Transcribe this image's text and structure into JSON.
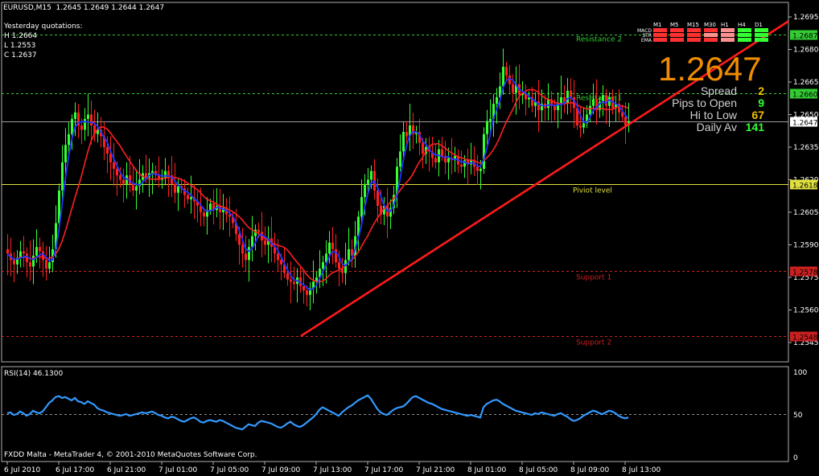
{
  "chart_title": "EURUSD,M15  1.2645 1.2649 1.2644 1.2647",
  "yesterday": {
    "label": "Yesterday quotations:",
    "high": "H 1.2664",
    "low": "L 1.2553",
    "close": "C 1.2637"
  },
  "info_panel": {
    "price": "1.2647",
    "rows": [
      {
        "label": "Spread",
        "value": "2",
        "color": "#f0c000"
      },
      {
        "label": "Pips to Open",
        "value": "9",
        "color": "#33ff33"
      },
      {
        "label": "Hi to Low",
        "value": "67",
        "color": "#f0c000"
      },
      {
        "label": "Daily Av",
        "value": "141",
        "color": "#33ff33"
      }
    ]
  },
  "signal_matrix": {
    "timeframes": [
      "M1",
      "M5",
      "M15",
      "M30",
      "H1",
      "H4",
      "D1"
    ],
    "indicators": [
      "MACD",
      "STR",
      "EMA"
    ],
    "cells": [
      [
        "#ff3030",
        "#ff3030",
        "#ff3030",
        "#ff3030",
        "#ff9090",
        "#33ff33",
        "#33ff33"
      ],
      [
        "#ff3030",
        "#ff3030",
        "#ff3030",
        "#ff9090",
        "#ff9090",
        "#33ff33",
        "#33ff33"
      ],
      [
        "#ff3030",
        "#ff3030",
        "#ff3030",
        "#ff3030",
        "#ff9090",
        "#33ff33",
        "#33ff33"
      ]
    ]
  },
  "levels": [
    {
      "name": "Resistance 2",
      "label": "Resistance 2",
      "price": 1.2687,
      "tag": "1.2687",
      "color": "#33cc33",
      "tag_bg": "#33cc33",
      "tag_fg": "#000000",
      "dashed": true
    },
    {
      "name": "Resistance 1",
      "label": "Resistance 1",
      "price": 1.266,
      "tag": "1.2660",
      "color": "#33cc33",
      "tag_bg": "#33cc33",
      "tag_fg": "#000000",
      "dashed": true
    },
    {
      "name": "current-price",
      "label": "",
      "price": 1.2647,
      "tag": "1.2647",
      "color": "#a0a0a0",
      "tag_bg": "#ffffff",
      "tag_fg": "#000000",
      "dashed": false
    },
    {
      "name": "Piviot level",
      "label": "Piviot level",
      "price": 1.2618,
      "tag": "1.2618",
      "color": "#e0e040",
      "tag_bg": "#e0e040",
      "tag_fg": "#000000",
      "dashed": false
    },
    {
      "name": "Support 1",
      "label": "Support 1",
      "price": 1.2578,
      "tag": "1.2578",
      "color": "#cc2020",
      "tag_bg": "#cc2020",
      "tag_fg": "#000000",
      "dashed": true
    },
    {
      "name": "Support 2",
      "label": "Support 2",
      "price": 1.2548,
      "tag": "1.2548",
      "color": "#cc2020",
      "tag_bg": "#cc2020",
      "tag_fg": "#000000",
      "dashed": true
    }
  ],
  "rsi": {
    "label": "RSI(14) 46.1300",
    "ticks": [
      "100",
      "50",
      "0"
    ],
    "level": 50
  },
  "footer": "FXDD Malta - MetaTrader 4, © 2001-2010 MetaQuotes Software Corp.",
  "colors": {
    "bull": "#33ff33",
    "bear": "#ff2020",
    "fast_ma": "#2233ff",
    "slow_ma": "#ff2020",
    "trendline": "#ff1a1a",
    "rsi": "#3399ff"
  },
  "chart_data": [
    {
      "type": "candlestick",
      "title": "EURUSD,M15",
      "ylim": [
        1.254,
        1.27
      ],
      "y_ticks": [
        "1.2695",
        "1.2680",
        "1.2665",
        "1.2650",
        "1.2635",
        "1.2620",
        "1.2605",
        "1.2590",
        "1.2575",
        "1.2560",
        "1.2545"
      ],
      "x_ticks": [
        "6 Jul 2010",
        "6 Jul 17:00",
        "6 Jul 21:00",
        "7 Jul 01:00",
        "7 Jul 05:00",
        "7 Jul 09:00",
        "7 Jul 13:00",
        "7 Jul 17:00",
        "7 Jul 21:00",
        "8 Jul 01:00",
        "8 Jul 05:00",
        "8 Jul 09:00",
        "8 Jul 13:00"
      ],
      "bars_per_tick": 16,
      "trendline": {
        "from": {
          "x": "7 Jul 12:00",
          "y": 1.2548
        },
        "to": {
          "x": "8 Jul 15:45",
          "y": 1.2693
        }
      },
      "fast_ma_offset": 0.0003,
      "slow_ma_offset": 0.001,
      "close": [
        1.2586,
        1.2583,
        1.2581,
        1.2584,
        1.2587,
        1.2586,
        1.2582,
        1.258,
        1.2585,
        1.2589,
        1.2587,
        1.2583,
        1.2579,
        1.2582,
        1.2588,
        1.26,
        1.2615,
        1.2628,
        1.2636,
        1.2641,
        1.2648,
        1.2651,
        1.2645,
        1.2643,
        1.2648,
        1.265,
        1.2645,
        1.2641,
        1.2643,
        1.264,
        1.2635,
        1.2632,
        1.2628,
        1.2625,
        1.2622,
        1.262,
        1.2618,
        1.2622,
        1.2618,
        1.2615,
        1.2617,
        1.262,
        1.2623,
        1.2621,
        1.2623,
        1.2624,
        1.2622,
        1.262,
        1.2621,
        1.2624,
        1.2622,
        1.2618,
        1.2614,
        1.2617,
        1.2616,
        1.2613,
        1.2611,
        1.2612,
        1.261,
        1.2608,
        1.2605,
        1.2603,
        1.2606,
        1.2609,
        1.2606,
        1.2608,
        1.2605,
        1.2607,
        1.2604,
        1.2603,
        1.26,
        1.2595,
        1.259,
        1.2586,
        1.2583,
        1.2589,
        1.2594,
        1.2597,
        1.2596,
        1.2592,
        1.259,
        1.2593,
        1.2589,
        1.2586,
        1.2583,
        1.2581,
        1.2577,
        1.2574,
        1.2573,
        1.2572,
        1.2575,
        1.2571,
        1.2569,
        1.2567,
        1.257,
        1.2573,
        1.2575,
        1.2579,
        1.2582,
        1.2586,
        1.2591,
        1.2588,
        1.2582,
        1.2579,
        1.2577,
        1.2583,
        1.2588,
        1.2585,
        1.2594,
        1.2603,
        1.2612,
        1.2618,
        1.262,
        1.2624,
        1.2615,
        1.2608,
        1.2604,
        1.2608,
        1.2603,
        1.2607,
        1.2613,
        1.2626,
        1.2633,
        1.2642,
        1.264,
        1.2645,
        1.2641,
        1.2642,
        1.2637,
        1.2632,
        1.2635,
        1.2633,
        1.263,
        1.2628,
        1.2634,
        1.2631,
        1.2628,
        1.263,
        1.2629,
        1.2631,
        1.2627,
        1.2626,
        1.2629,
        1.2627,
        1.2629,
        1.2626,
        1.2624,
        1.2625,
        1.2641,
        1.2647,
        1.2648,
        1.2655,
        1.2658,
        1.2663,
        1.2672,
        1.2668,
        1.2664,
        1.266,
        1.2664,
        1.2659,
        1.266,
        1.2657,
        1.2658,
        1.2654,
        1.2656,
        1.2652,
        1.2655,
        1.2653,
        1.2657,
        1.2654,
        1.2652,
        1.2655,
        1.2658,
        1.2655,
        1.2661,
        1.2658,
        1.2653,
        1.2645,
        1.2644,
        1.2646,
        1.265,
        1.2654,
        1.2657,
        1.2652,
        1.2656,
        1.2659,
        1.2654,
        1.2658,
        1.2653,
        1.2655,
        1.2651,
        1.2649,
        1.2645,
        1.2647
      ],
      "rsi_values": [
        51,
        52,
        49,
        50,
        53,
        51,
        48,
        50,
        54,
        52,
        51,
        53,
        58,
        63,
        66,
        70,
        71,
        69,
        70,
        68,
        66,
        69,
        65,
        64,
        62,
        65,
        63,
        61,
        57,
        55,
        54,
        52,
        51,
        50,
        49,
        48,
        49,
        50,
        48,
        49,
        50,
        51,
        52,
        51,
        52,
        53,
        51,
        49,
        48,
        46,
        45,
        47,
        46,
        44,
        42,
        41,
        43,
        45,
        46,
        44,
        41,
        40,
        42,
        43,
        42,
        41,
        43,
        42,
        40,
        38,
        36,
        34,
        33,
        32,
        35,
        38,
        37,
        36,
        40,
        42,
        41,
        40,
        39,
        37,
        35,
        34,
        36,
        39,
        41,
        38,
        36,
        35,
        37,
        40,
        43,
        46,
        50,
        55,
        58,
        56,
        54,
        52,
        50,
        48,
        52,
        55,
        58,
        60,
        63,
        66,
        68,
        70,
        72,
        68,
        62,
        56,
        52,
        50,
        49,
        52,
        55,
        57,
        58,
        59,
        62,
        66,
        70,
        71,
        69,
        67,
        65,
        63,
        62,
        60,
        58,
        56,
        55,
        54,
        53,
        52,
        51,
        50,
        49,
        48,
        49,
        48,
        47,
        46,
        58,
        62,
        64,
        66,
        67,
        65,
        62,
        60,
        58,
        56,
        54,
        53,
        52,
        51,
        50,
        49,
        51,
        50,
        52,
        51,
        50,
        49,
        48,
        50,
        51,
        49,
        47,
        44,
        42,
        43,
        45,
        48,
        50,
        52,
        54,
        53,
        51,
        50,
        52,
        54,
        53,
        51,
        48,
        46,
        45,
        46
      ]
    }
  ]
}
